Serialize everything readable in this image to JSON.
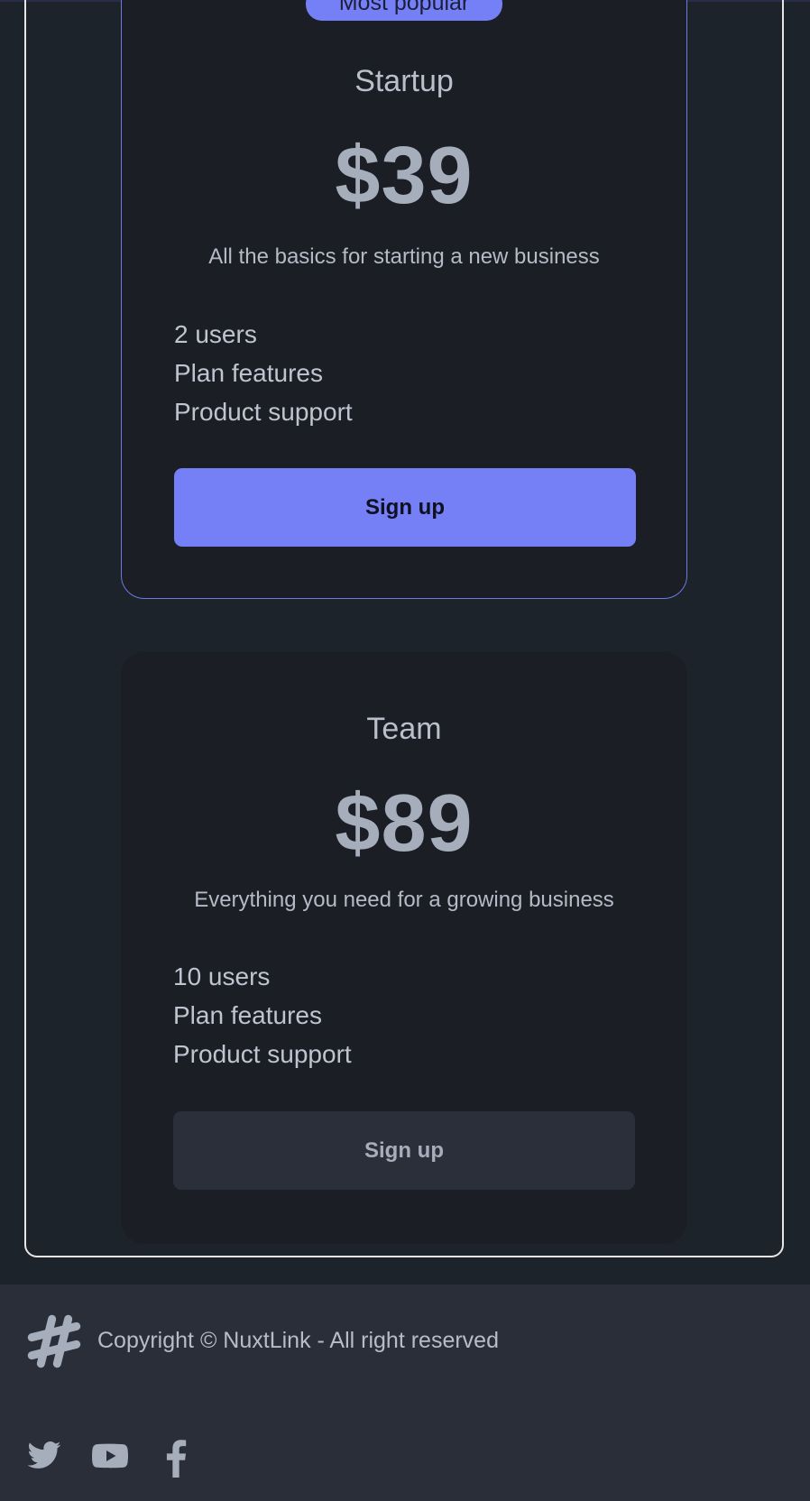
{
  "plans": [
    {
      "badge": "Most popular",
      "name": "Startup",
      "price": "$39",
      "description": "All the basics for starting a new business",
      "features": [
        "2 users",
        "Plan features",
        "Product support"
      ],
      "button_label": "Sign up"
    },
    {
      "name": "Team",
      "price": "$89",
      "description": "Everything you need for a growing business",
      "features": [
        "10 users",
        "Plan features",
        "Product support"
      ],
      "button_label": "Sign up"
    }
  ],
  "footer": {
    "logo_icon": "hashtag-icon",
    "copyright": "Copyright © NuxtLink - All right reserved",
    "social": [
      {
        "icon": "twitter-icon"
      },
      {
        "icon": "youtube-icon"
      },
      {
        "icon": "facebook-icon"
      }
    ]
  },
  "colors": {
    "background": "#1d232a",
    "card": "#1b1e24",
    "primary": "#7580f7",
    "footer": "#2a2e39",
    "text": "#a6adbb"
  }
}
